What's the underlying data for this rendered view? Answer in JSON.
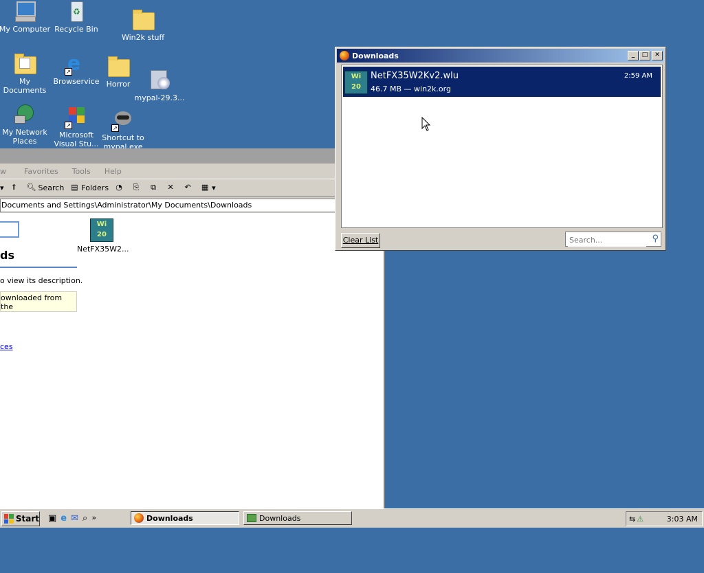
{
  "desktop": {
    "icons": [
      {
        "label": "My Computer"
      },
      {
        "label": "Recycle Bin"
      },
      {
        "label": "Win2k stuff"
      },
      {
        "label": "My Documents"
      },
      {
        "label": "Browservice"
      },
      {
        "label": "Horror"
      },
      {
        "label": "mypal-29.3..."
      },
      {
        "label": "My Network Places"
      },
      {
        "label": "Microsoft Visual Stu..."
      },
      {
        "label": "Shortcut to mypal.exe"
      }
    ]
  },
  "explorer": {
    "menu": [
      "w",
      "Favorites",
      "Tools",
      "Help"
    ],
    "toolbar": {
      "search": "Search",
      "folders": "Folders"
    },
    "address": "Documents and Settings\\Administrator\\My Documents\\Downloads",
    "side": {
      "heading": "ds",
      "desc": "o view its description.",
      "note": "ownloaded from the",
      "link": "ces"
    },
    "file_label": "NetFX35W2..."
  },
  "downloads": {
    "title": "Downloads",
    "item": {
      "name": "NetFX35W2Kv2.wlu",
      "meta": "46.7 MB — win2k.org",
      "time": "2:59 AM"
    },
    "clear_label": "Clear List",
    "search_placeholder": "Search..."
  },
  "taskbar": {
    "start": "Start",
    "tasks": [
      {
        "label": "Downloads"
      },
      {
        "label": "Downloads"
      }
    ],
    "clock": "3:03 AM"
  }
}
